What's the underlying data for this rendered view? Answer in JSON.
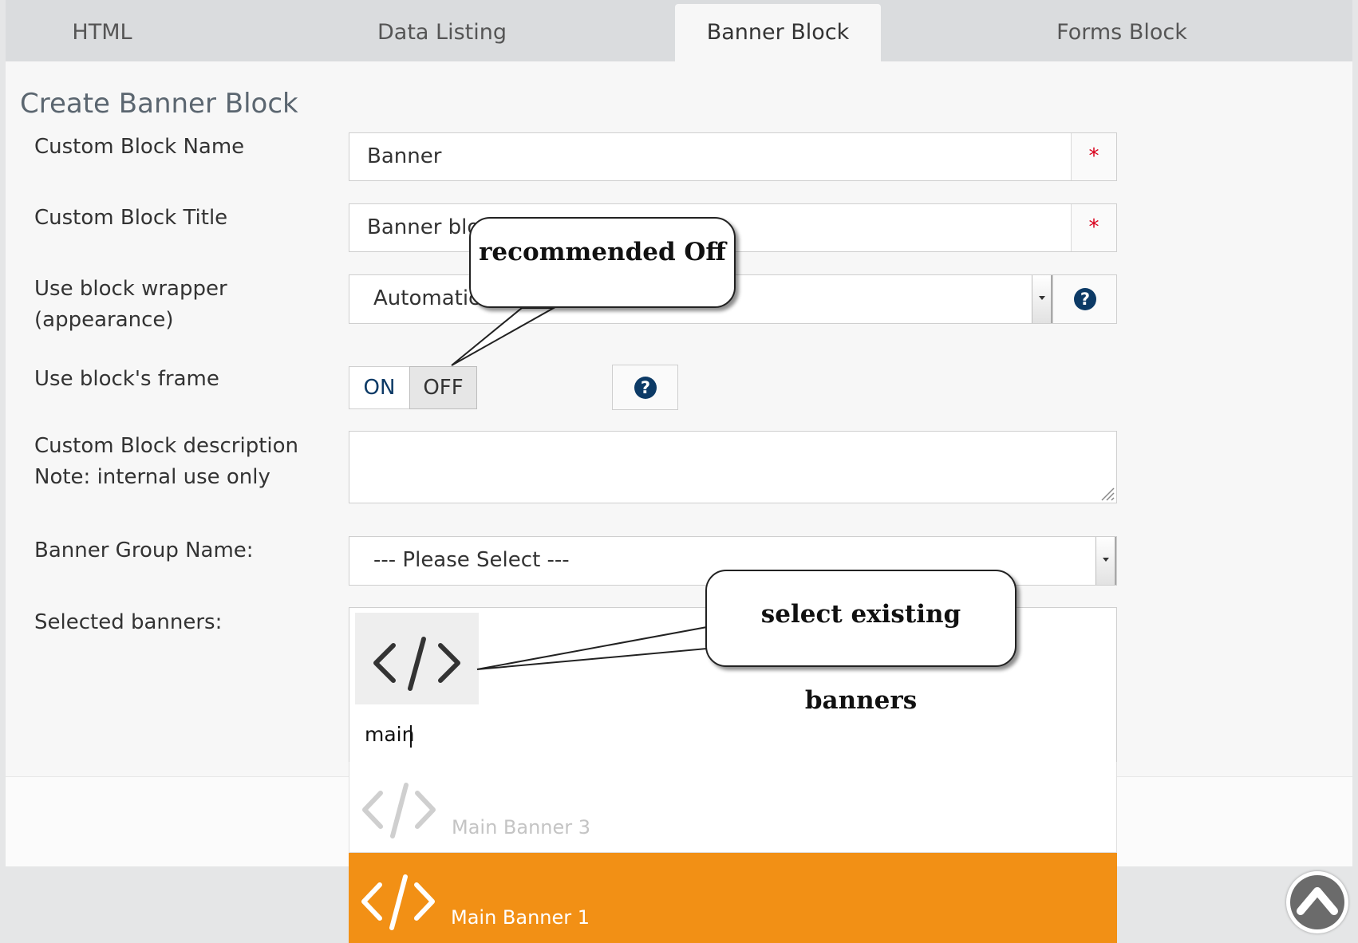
{
  "tabs": [
    {
      "label": "HTML",
      "active": false
    },
    {
      "label": "Data Listing",
      "active": false
    },
    {
      "label": "Banner Block",
      "active": true
    },
    {
      "label": "Forms Block",
      "active": false
    }
  ],
  "form": {
    "title": "Create Banner Block",
    "name": {
      "label": "Custom Block Name",
      "value": "Banner",
      "required_mark": "*"
    },
    "block_title": {
      "label": "Custom Block Title",
      "value": "Banner blo",
      "required_mark": "*"
    },
    "wrapper": {
      "label_line1": "Use block wrapper",
      "label_line2": "(appearance)",
      "value": "Automatic",
      "help": "?"
    },
    "frame": {
      "label": "Use block's frame",
      "on_label": "ON",
      "off_label": "OFF",
      "selected": "OFF",
      "help": "?"
    },
    "description": {
      "label_line1": "Custom Block description",
      "label_line2": "Note: internal use only",
      "value": ""
    },
    "group": {
      "label": "Banner Group Name:",
      "value": "--- Please Select ---"
    },
    "selected": {
      "label": "Selected banners:",
      "search_value": "main"
    }
  },
  "dropdown": {
    "items": [
      {
        "label": "Main Banner 3",
        "icon": "code-icon",
        "highlighted": false
      },
      {
        "label": "Main Banner 1",
        "icon": "code-icon",
        "highlighted": true
      }
    ],
    "highlight_color": "#f29015"
  },
  "callouts": {
    "off_note": "recommended Off",
    "banners_note": "select existing banners"
  },
  "colors": {
    "accent": "#0c3a66",
    "required": "#d9001b"
  }
}
